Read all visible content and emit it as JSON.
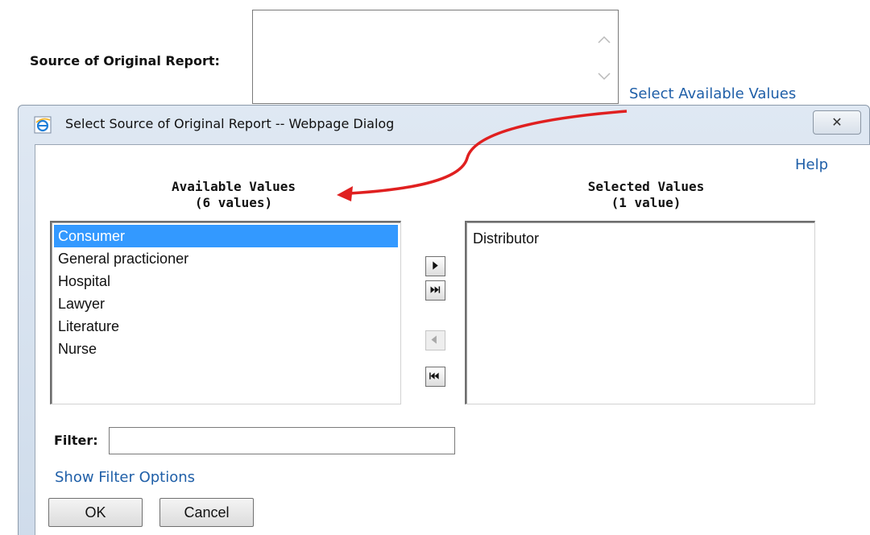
{
  "form": {
    "source_label": "Source of Original Report:",
    "select_link": "Select Available Values"
  },
  "dialog": {
    "title": "Select Source of Original Report -- Webpage Dialog",
    "close_glyph": "✕",
    "help_link": "Help",
    "available": {
      "heading": "Available Values",
      "count": "(6 values)",
      "items": [
        {
          "label": "Consumer",
          "selected": true
        },
        {
          "label": "General practicioner",
          "selected": false
        },
        {
          "label": "Hospital",
          "selected": false
        },
        {
          "label": "Lawyer",
          "selected": false
        },
        {
          "label": "Literature",
          "selected": false
        },
        {
          "label": "Nurse",
          "selected": false
        }
      ]
    },
    "selected": {
      "heading": "Selected Values",
      "count": "(1 value)",
      "items": [
        {
          "label": "Distributor"
        }
      ]
    },
    "buttons": {
      "add_icon": "arrow-right-icon",
      "add_all_icon": "double-arrow-right-icon",
      "remove_icon": "arrow-left-icon",
      "remove_all_icon": "double-arrow-left-icon",
      "remove_enabled": false,
      "ok": "OK",
      "cancel": "Cancel"
    },
    "filter": {
      "label": "Filter:",
      "value": "",
      "show_options_link": "Show Filter Options"
    }
  },
  "annotation": {
    "arrow_color": "#e02020"
  },
  "colors": {
    "link": "#1f5fa8",
    "selection": "#3399ff"
  }
}
